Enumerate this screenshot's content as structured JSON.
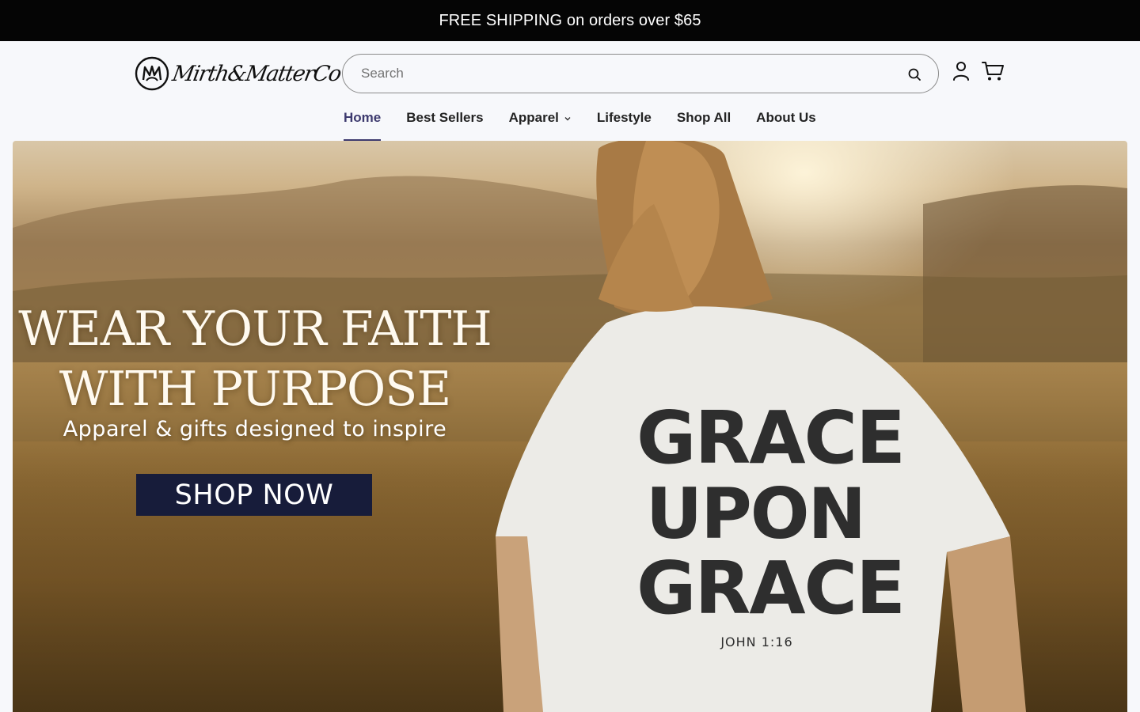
{
  "announcement": {
    "text": "FREE SHIPPING on orders over $65"
  },
  "brand": {
    "name": "Mirth&MatterCo"
  },
  "search": {
    "placeholder": "Search"
  },
  "nav": {
    "items": [
      {
        "label": "Home",
        "active": true
      },
      {
        "label": "Best Sellers",
        "active": false
      },
      {
        "label": "Apparel",
        "active": false,
        "has_dropdown": true
      },
      {
        "label": "Lifestyle",
        "active": false
      },
      {
        "label": "Shop All",
        "active": false
      },
      {
        "label": "About Us",
        "active": false
      }
    ]
  },
  "hero": {
    "title_line1": "WEAR YOUR FAITH",
    "title_line2": "WITH PURPOSE",
    "subtitle": "Apparel & gifts designed to inspire",
    "cta": "SHOP NOW",
    "shirt": {
      "line1": "GRACE",
      "line2": "UPON",
      "line3": "GRACE",
      "verse": "JOHN 1:16"
    }
  },
  "icons": {
    "search": "search-icon",
    "account": "account-icon",
    "cart": "cart-icon",
    "dropdown": "chevron-down-icon"
  },
  "colors": {
    "announcement_bg": "#050505",
    "nav_active": "#3d3a6e",
    "cta_bg": "#171c3a"
  }
}
